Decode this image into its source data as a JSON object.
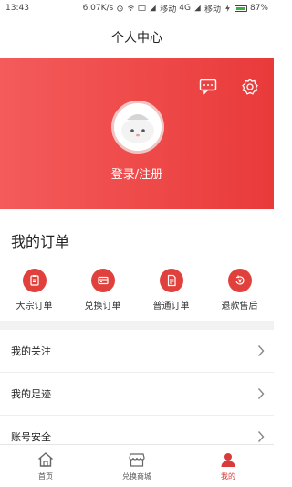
{
  "status_bar": {
    "time": "13:43",
    "speed": "6.07K/s",
    "carrier1": "移动",
    "network": "4G",
    "carrier2": "移动",
    "battery": "87%",
    "battery_level": 0.87
  },
  "header": {
    "title": "个人中心"
  },
  "profile": {
    "login_label": "登录/注册",
    "icons": [
      "message-icon",
      "settings-icon"
    ]
  },
  "orders": {
    "title": "我的订单",
    "items": [
      {
        "label": "大宗订单",
        "icon": "clipboard-icon"
      },
      {
        "label": "兑换订单",
        "icon": "card-icon"
      },
      {
        "label": "普通订单",
        "icon": "document-icon"
      },
      {
        "label": "退款售后",
        "icon": "refund-icon"
      }
    ]
  },
  "menu": {
    "items": [
      {
        "label": "我的关注"
      },
      {
        "label": "我的足迹"
      },
      {
        "label": "账号安全"
      }
    ]
  },
  "tabbar": {
    "items": [
      {
        "label": "首页",
        "icon": "home-icon"
      },
      {
        "label": "兑换商城",
        "icon": "store-icon"
      },
      {
        "label": "我的",
        "icon": "user-icon"
      }
    ],
    "active_index": 2
  },
  "colors": {
    "accent": "#e93a3a",
    "hero_start": "#f45b5b",
    "hero_end": "#e93a3a"
  }
}
